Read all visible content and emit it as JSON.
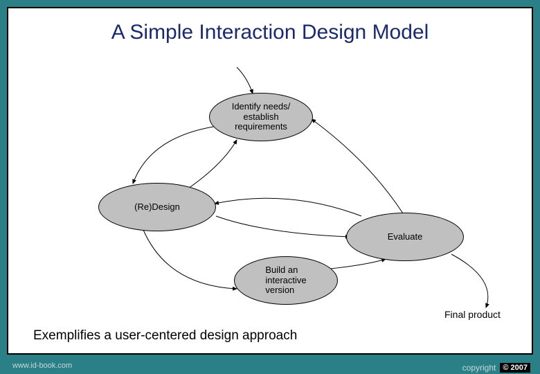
{
  "slide": {
    "title": "A Simple Interaction Design Model",
    "caption": "Exemplifies a user-centered design approach",
    "nodes": {
      "identify": "Identify needs/\nestablish\nrequirements",
      "redesign": "(Re)Design",
      "evaluate": "Evaluate",
      "build": "Build an\ninteractive\nversion"
    },
    "final_label": "Final product",
    "arrows": [
      {
        "from": "identify",
        "to": "redesign"
      },
      {
        "from": "redesign",
        "to": "build"
      },
      {
        "from": "build",
        "to": "evaluate"
      },
      {
        "from": "evaluate",
        "to": "identify"
      },
      {
        "from": "evaluate",
        "to": "redesign"
      },
      {
        "from": "redesign",
        "to": "identify"
      },
      {
        "from": "evaluate",
        "to": "final_product"
      }
    ]
  },
  "footer": {
    "url": "www.id-book.com",
    "copyright_prefix": "copyright",
    "copyright_badge": "© 2007"
  },
  "colors": {
    "frame": "#2a8086",
    "node_fill": "#c0c0c0",
    "title_color": "#1a2a6c"
  }
}
